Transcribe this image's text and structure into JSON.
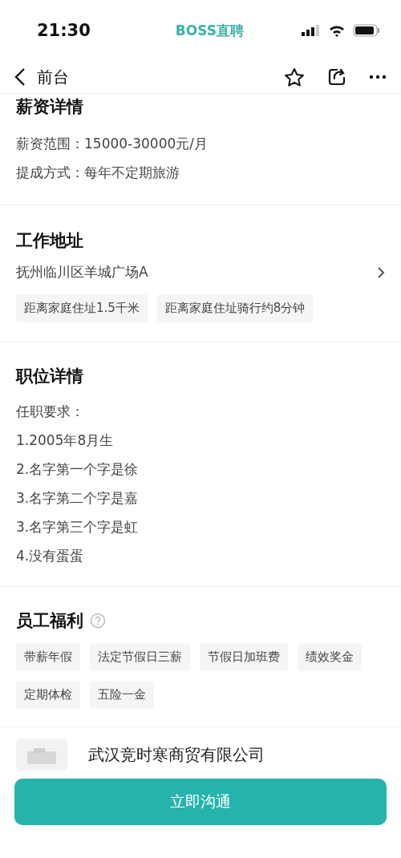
{
  "status_bar": {
    "time": "21:30",
    "app_name": "BOSS直聘"
  },
  "nav": {
    "title": "前台"
  },
  "salary": {
    "title": "薪资详情",
    "lines": [
      "薪资范围：15000-30000元/月",
      "提成方式：每年不定期旅游"
    ]
  },
  "address": {
    "title": "工作地址",
    "text": "抚州临川区羊城广场A",
    "tags": [
      "距离家庭住址1.5千米",
      "距离家庭住址骑行约8分钟"
    ]
  },
  "job": {
    "title": "职位详情",
    "lines": [
      "任职要求：",
      "1.2005年8月生",
      "2.名字第一个字是徐",
      "3.名字第二个字是嘉",
      "3.名字第三个字是虹",
      "4.没有蛋蛋"
    ]
  },
  "benefits": {
    "title": "员工福利",
    "tags": [
      "带薪年假",
      "法定节假日三薪",
      "节假日加班费",
      "绩效奖金",
      "定期体检",
      "五险一金"
    ]
  },
  "company": {
    "name": "武汉竞时寒商贸有限公司"
  },
  "action_button": "立即沟通"
}
